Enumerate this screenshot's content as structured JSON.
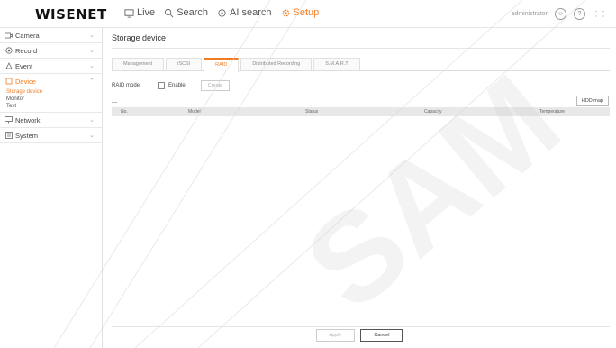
{
  "topbar": {
    "logo": "WISENET",
    "nav": [
      {
        "label": "Live",
        "icon": "monitor-icon"
      },
      {
        "label": "Search",
        "icon": "search-icon"
      },
      {
        "label": "AI search",
        "icon": "ai-search-icon"
      },
      {
        "label": "Setup",
        "icon": "gear-icon"
      }
    ],
    "user_label": "administrator",
    "accent": "#f27b21"
  },
  "sidebar": {
    "items": [
      {
        "label": "Camera",
        "icon": "camera-icon"
      },
      {
        "label": "Record",
        "icon": "record-icon"
      },
      {
        "label": "Event",
        "icon": "event-icon"
      },
      {
        "label": "Device",
        "icon": "device-icon"
      },
      {
        "label": "Network",
        "icon": "network-icon"
      },
      {
        "label": "System",
        "icon": "system-icon"
      }
    ],
    "sub_items": [
      "Storage device",
      "Monitor",
      "Text"
    ]
  },
  "main": {
    "title": "Storage device",
    "tabs": [
      "Management",
      "iSCSI",
      "RAID",
      "Distributed Recording",
      "S.M.A.R.T"
    ],
    "raid_mode_label": "RAID mode",
    "enable_label": "Enable",
    "create_label": "Create",
    "hdd_map_label": "HDD map",
    "columns": [
      "No.",
      "Model",
      "Status",
      "Capacity",
      "Temperature"
    ],
    "apply_label": "Apply",
    "cancel_label": "Cancel"
  },
  "watermark_text": "SAM"
}
